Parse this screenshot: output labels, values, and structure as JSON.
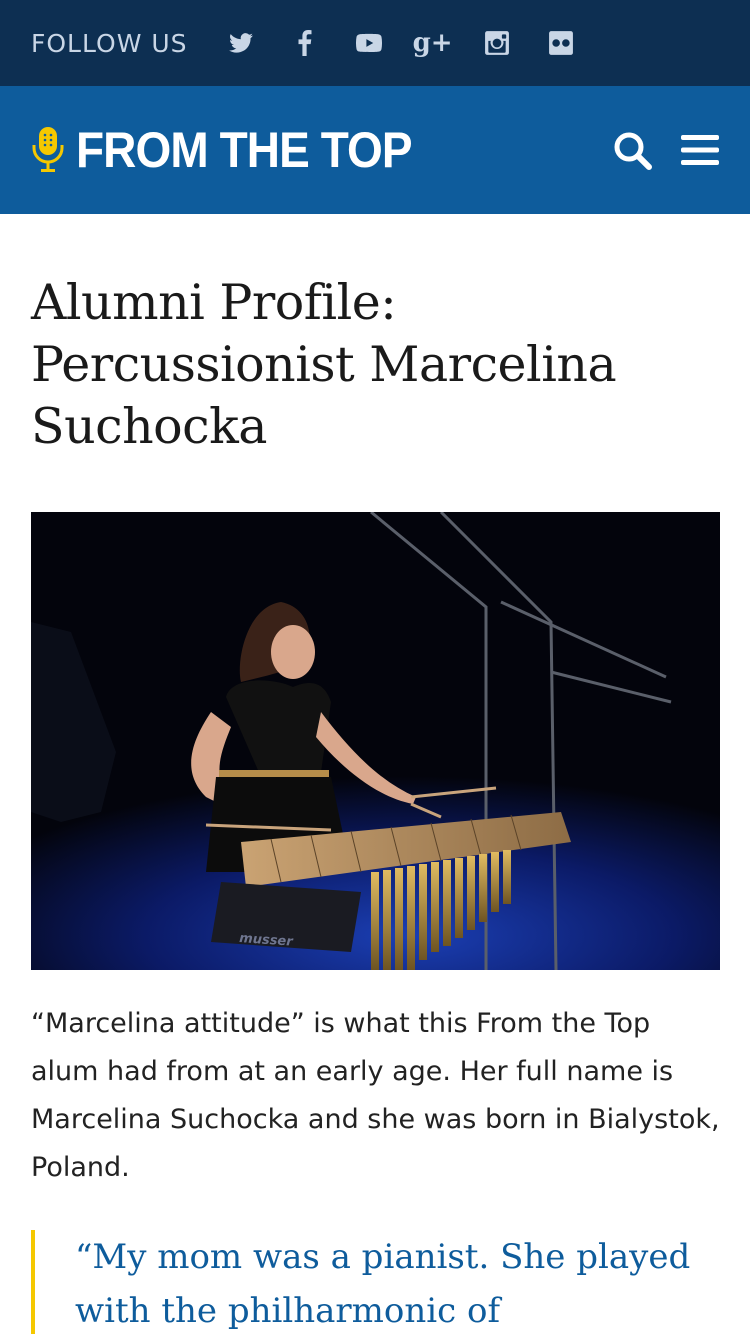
{
  "follow_bar": {
    "label": "FOLLOW US",
    "icons": [
      "twitter-icon",
      "facebook-icon",
      "youtube-icon",
      "google-plus-icon",
      "instagram-icon",
      "flickr-icon"
    ],
    "google_plus_text": "g+",
    "background": "#0d2f52"
  },
  "header": {
    "logo_text": "FROM THE TOP",
    "background": "#0e5c9c",
    "accent": "#f5c800"
  },
  "article": {
    "title": "Alumni Profile: Percussionist Marcelina Suchocka",
    "photo_brand": "musser",
    "intro": "“Marcelina attitude” is what this From the Top alum had from at an early age. Her full name is Marcelina Suchocka and she was born in Bialystok, Poland.",
    "quote": "“My mom was a pianist. She played with the philharmonic of"
  }
}
